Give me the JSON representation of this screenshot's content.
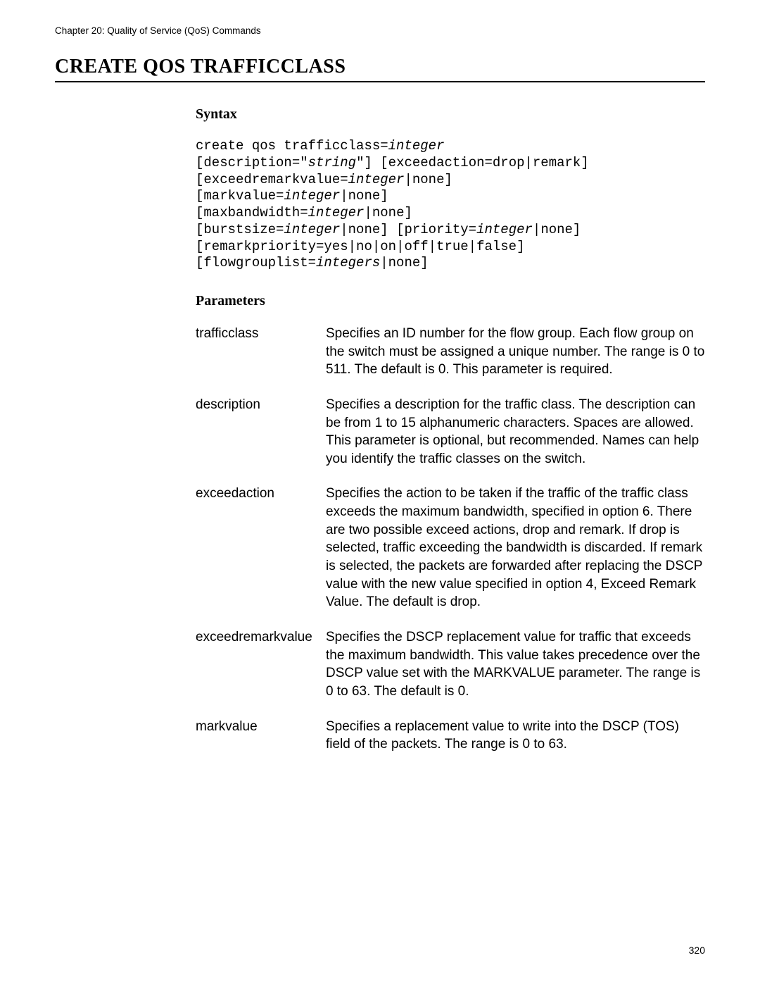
{
  "chapter_header": "Chapter 20: Quality of Service (QoS) Commands",
  "title": "CREATE QOS TRAFFICCLASS",
  "sections": {
    "syntax_heading": "Syntax",
    "parameters_heading": "Parameters"
  },
  "syntax": {
    "l1a": "create qos trafficclass=",
    "l1b": "integer",
    "l2a": "[description=\"",
    "l2b": "string",
    "l2c": "\"] [exceedaction=drop|remark]",
    "l3a": "[exceedremarkvalue=",
    "l3b": "integer",
    "l3c": "|none]",
    "l4a": "[markvalue=",
    "l4b": "integer",
    "l4c": "|none]",
    "l5a": "[maxbandwidth=",
    "l5b": "integer",
    "l5c": "|none]",
    "l6a": "[burstsize=",
    "l6b": "integer",
    "l6c": "|none] [priority=",
    "l6d": "integer",
    "l6e": "|none]",
    "l7": "[remarkpriority=yes|no|on|off|true|false]",
    "l8a": "[flowgrouplist=",
    "l8b": "integers",
    "l8c": "|none]"
  },
  "parameters": [
    {
      "name": "trafficclass",
      "desc": "Specifies an ID number for the flow group. Each flow group on the switch must be assigned a unique number. The range is 0 to 511. The default is 0. This parameter is required."
    },
    {
      "name": "description",
      "desc": "Specifies a description for the traffic class. The description can be from 1 to 15 alphanumeric characters. Spaces are allowed. This parameter is optional, but recommended. Names can help you identify the traffic classes on the switch."
    },
    {
      "name": "exceedaction",
      "desc": "Specifies the action to be taken if the traffic of the traffic class exceeds the maximum bandwidth, specified in option 6. There are two possible exceed actions, drop and remark. If drop is selected, traffic exceeding the bandwidth is discarded. If remark is selected, the packets are forwarded after replacing the DSCP value with the new value specified in option 4, Exceed Remark Value. The default is drop."
    },
    {
      "name": "exceedremarkvalue",
      "desc": "Specifies the DSCP replacement value for traffic that exceeds the maximum bandwidth. This value takes precedence over the DSCP value set with the MARKVALUE parameter. The range is 0 to 63. The default is 0."
    },
    {
      "name": "markvalue",
      "desc": "Specifies a replacement value to write into the DSCP (TOS) field of the packets. The range is 0 to 63."
    }
  ],
  "page_number": "320"
}
